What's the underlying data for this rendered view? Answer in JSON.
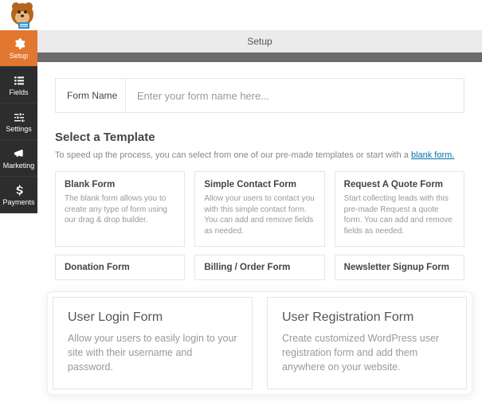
{
  "sidebar": {
    "items": [
      {
        "label": "Setup"
      },
      {
        "label": "Fields"
      },
      {
        "label": "Settings"
      },
      {
        "label": "Marketing"
      },
      {
        "label": "Payments"
      }
    ]
  },
  "topbar": {
    "title": "Setup"
  },
  "formName": {
    "label": "Form Name",
    "placeholder": "Enter your form name here..."
  },
  "selectTemplate": {
    "heading": "Select a Template",
    "sub_prefix": "To speed up the process, you can select from one of our pre-made templates or start with a ",
    "blank_link": "blank form."
  },
  "templates_row1": [
    {
      "title": "Blank Form",
      "desc": "The blank form allows you to create any type of form using our drag & drop builder."
    },
    {
      "title": "Simple Contact Form",
      "desc": "Allow your users to contact you with this simple contact form. You can add and remove fields as needed."
    },
    {
      "title": "Request A Quote Form",
      "desc": "Start collecting leads with this pre-made Request a quote form. You can add and remove fields as needed."
    }
  ],
  "templates_row2": [
    {
      "title": "Donation Form"
    },
    {
      "title": "Billing / Order Form"
    },
    {
      "title": "Newsletter Signup Form"
    }
  ],
  "templates_big": [
    {
      "title": "User Login Form",
      "desc": "Allow your users to easily login to your site with their username and password."
    },
    {
      "title": "User Registration Form",
      "desc": "Create customized WordPress user registration form and add them anywhere on your website."
    }
  ]
}
